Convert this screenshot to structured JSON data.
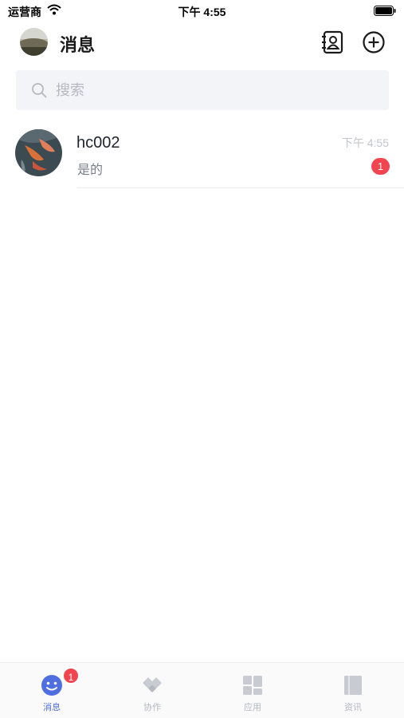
{
  "status_bar": {
    "carrier": "运营商",
    "time": "下午 4:55"
  },
  "header": {
    "title": "消息",
    "contacts_icon": "contacts-book-icon",
    "add_icon": "plus-circle-icon"
  },
  "search": {
    "placeholder": "搜索"
  },
  "conversations": [
    {
      "name": "hc002",
      "time": "下午 4:55",
      "preview": "是的",
      "unread": "1"
    }
  ],
  "tabs": [
    {
      "label": "消息",
      "icon": "smile-chat-icon",
      "active": true,
      "badge": "1"
    },
    {
      "label": "协作",
      "icon": "collaboration-icon",
      "active": false
    },
    {
      "label": "应用",
      "icon": "apps-grid-icon",
      "active": false
    },
    {
      "label": "资讯",
      "icon": "news-book-icon",
      "active": false
    }
  ],
  "colors": {
    "accent": "#4f6fe0",
    "badge": "#f2454f",
    "inactive_tab": "#b5b8c0"
  }
}
